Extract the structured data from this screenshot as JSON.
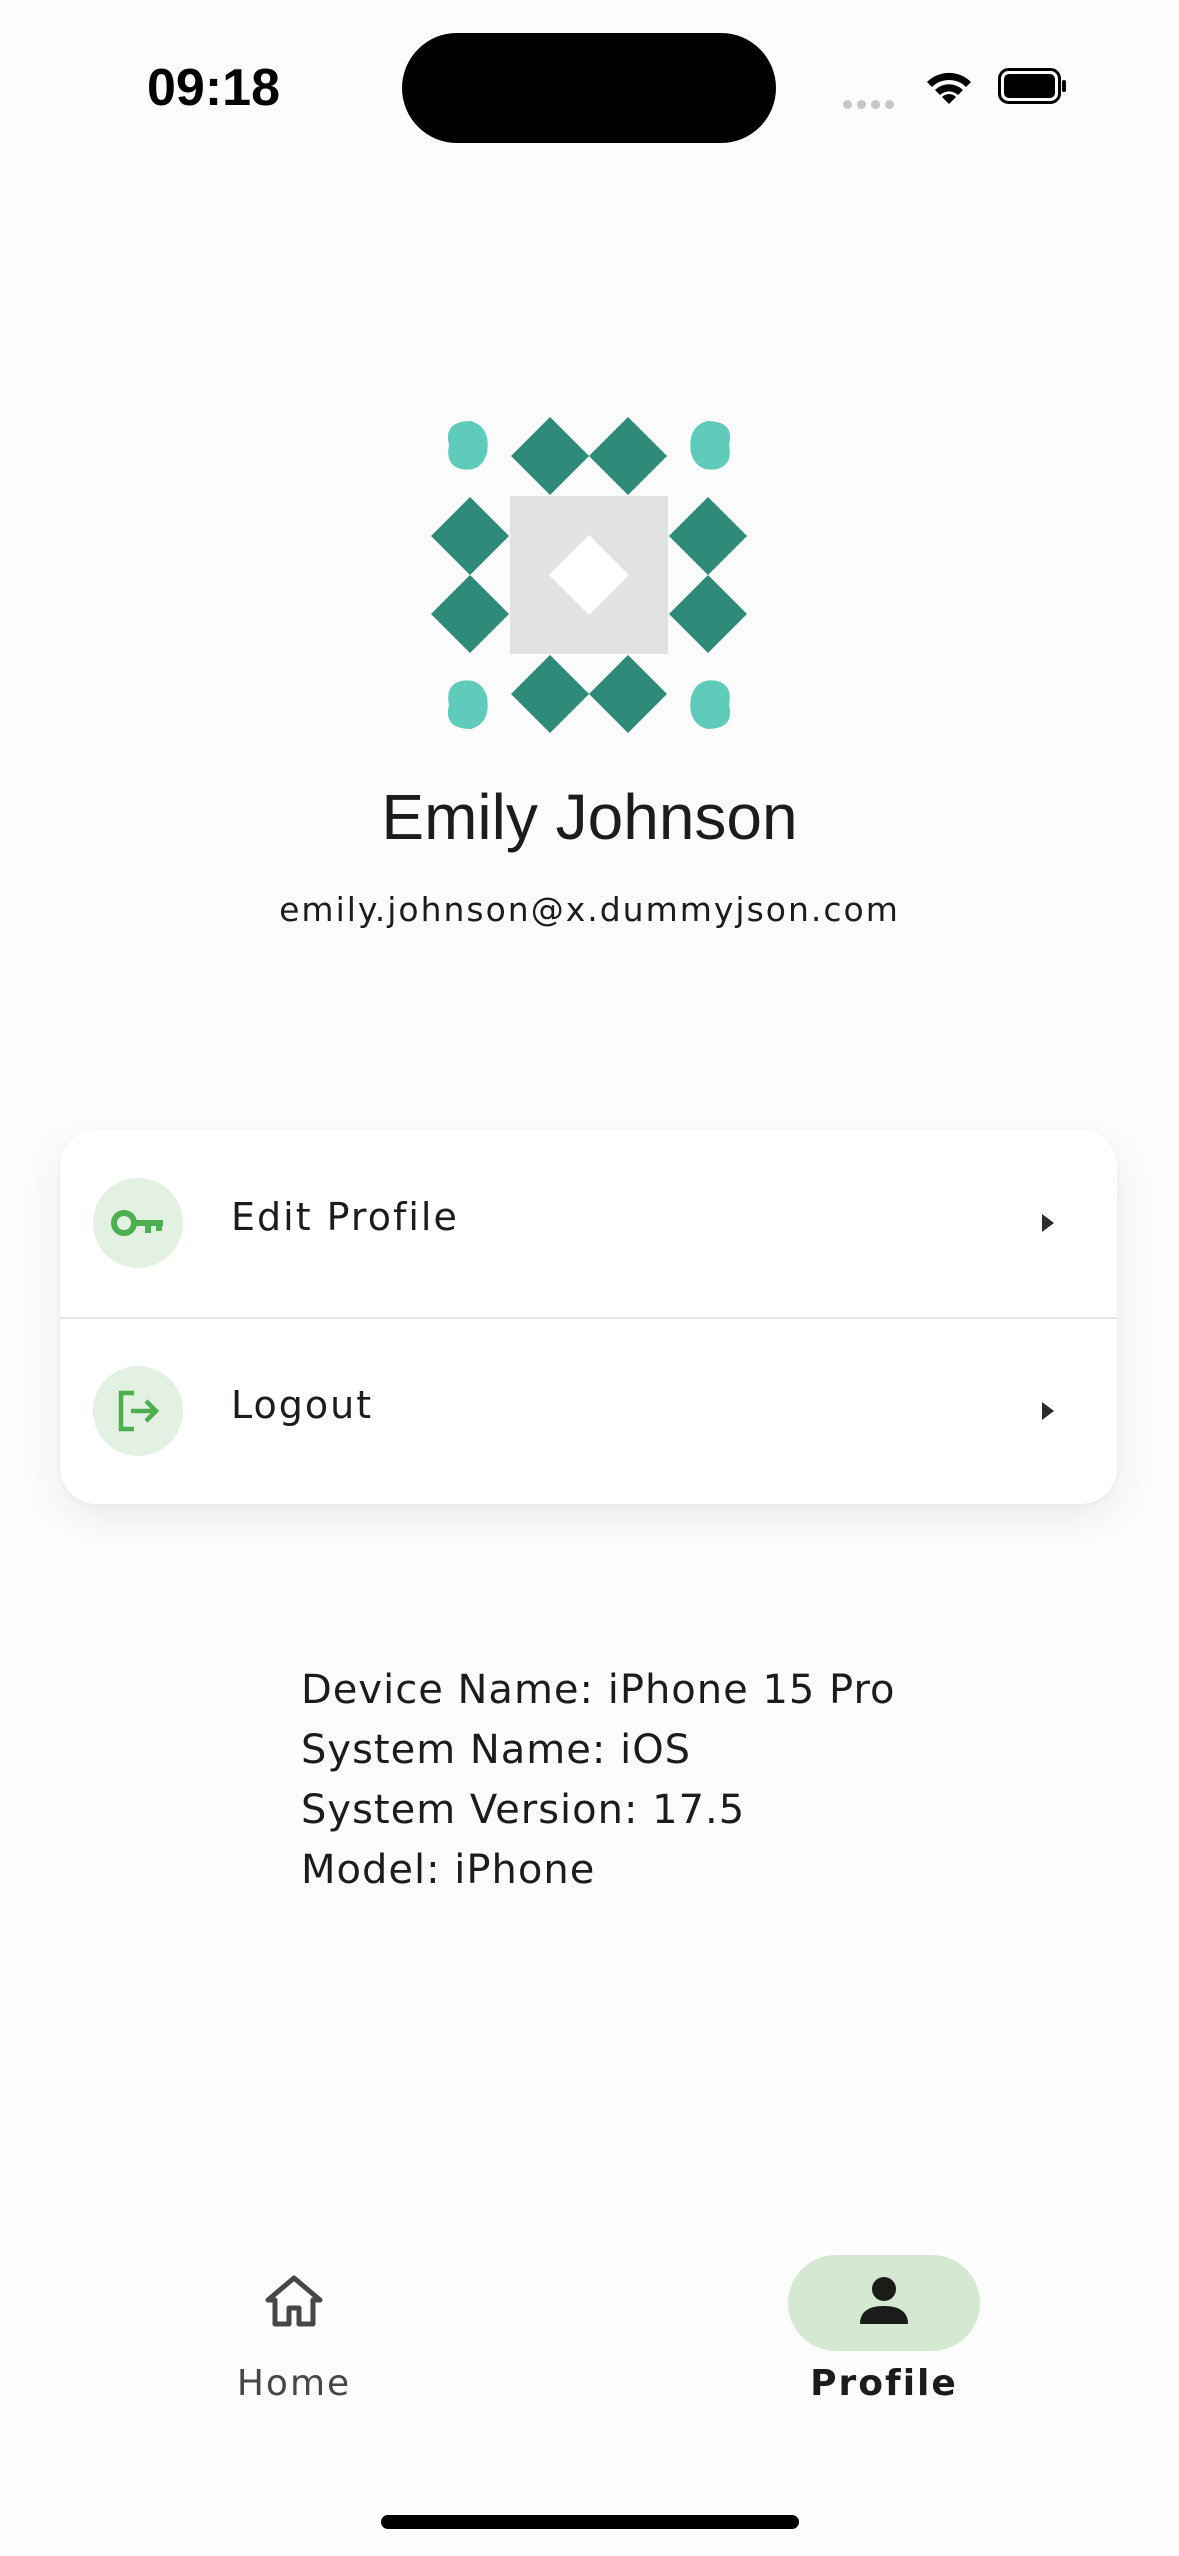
{
  "status_bar": {
    "time": "09:18"
  },
  "profile": {
    "name": "Emily Johnson",
    "email": "emily.johnson@x.dummyjson.com"
  },
  "menu": [
    {
      "label": "Edit Profile",
      "icon": "key-icon"
    },
    {
      "label": "Logout",
      "icon": "logout-icon"
    }
  ],
  "device_info": {
    "device_name": "Device Name: iPhone 15 Pro",
    "system_name": "System Name: iOS",
    "system_version": "System Version: 17.5",
    "model": "Model: iPhone"
  },
  "bottom_nav": {
    "items": [
      {
        "label": "Home",
        "icon": "home-icon",
        "selected": false
      },
      {
        "label": "Profile",
        "icon": "person-icon",
        "selected": true
      }
    ]
  },
  "colors": {
    "accent_green": "#4caf50",
    "icon_bg": "#e3f1e2",
    "nav_selected_bg": "#d5e8d2",
    "avatar_dark": "#2e8b7a",
    "avatar_light": "#5ecbbb"
  }
}
